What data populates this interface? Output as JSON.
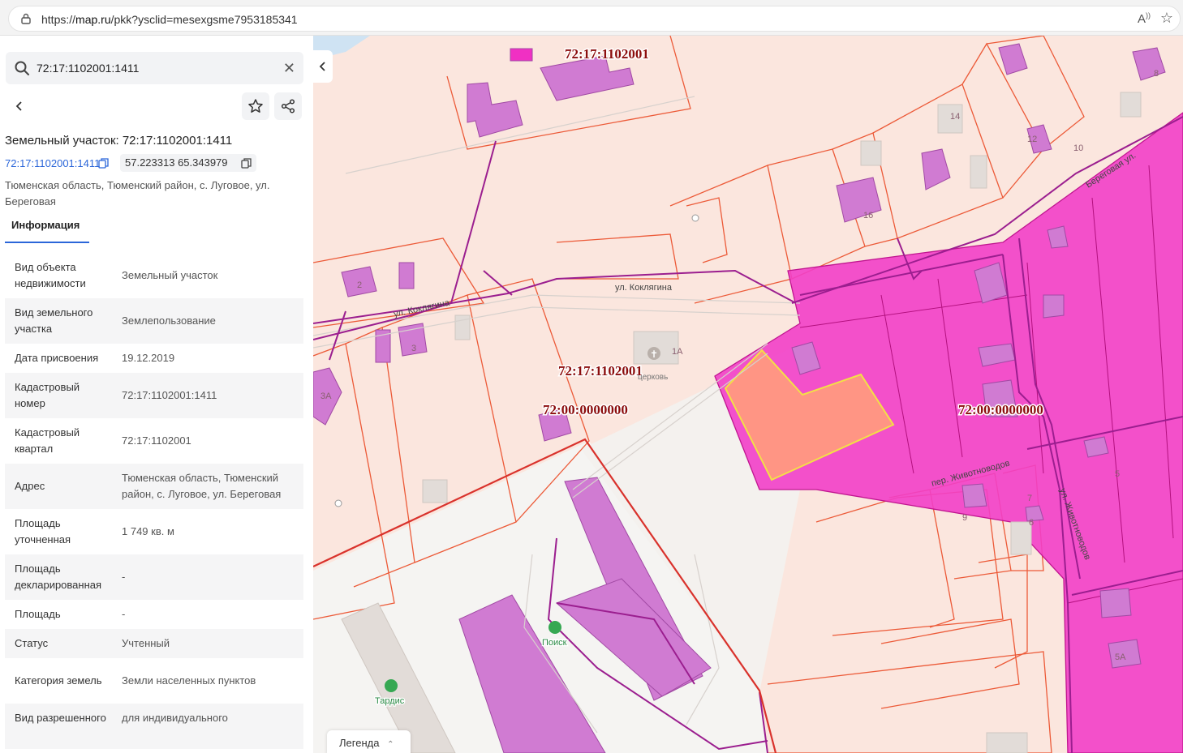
{
  "browser": {
    "url_prefix": "https://",
    "url_host": "map.ru",
    "url_path": "/pkk?ysclid=mesexgsme7953185341"
  },
  "search": {
    "value": "72:17:1102001:1411"
  },
  "parcel": {
    "title": "Земельный участок: 72:17:1102001:1411",
    "cad_number": "72:17:1102001:1411",
    "coordinates": "57.223313 65.343979",
    "address": "Тюменская область, Тюменский район, с. Луговое, ул. Береговая"
  },
  "tabs": {
    "info": "Информация"
  },
  "info_rows": [
    {
      "label": "Вид объекта недвижимости",
      "value": "Земельный участок"
    },
    {
      "label": "Вид земельного участка",
      "value": "Землепользование"
    },
    {
      "label": "Дата присвоения",
      "value": "19.12.2019"
    },
    {
      "label": "Кадастровый номер",
      "value": "72:17:1102001:1411"
    },
    {
      "label": "Кадастровый квартал",
      "value": "72:17:1102001"
    },
    {
      "label": "Адрес",
      "value": "Тюменская область, Тюменский район, с. Луговое, ул. Береговая"
    },
    {
      "label": "Площадь уточненная",
      "value": "1 749 кв. м"
    },
    {
      "label": "Площадь декларированная",
      "value": "-"
    },
    {
      "label": "Площадь",
      "value": "-"
    },
    {
      "label": "Статус",
      "value": "Учтенный"
    },
    {
      "label": "Категория земель",
      "value": "Земли населенных пунктов"
    },
    {
      "label": "Вид разрешенного",
      "value": "для индивидуального"
    }
  ],
  "map": {
    "quarter_labels": [
      "72:17:1102001",
      "72:17:1102001",
      "72:00:0000000",
      "72:00:0000000"
    ],
    "streets": [
      "ул. Коклягина",
      "ул. Коклягина",
      "пер. Животноводов",
      "ул. Животноводов",
      "Береговая ул."
    ],
    "house_numbers": [
      "2",
      "3",
      "3А",
      "1А",
      "14",
      "16",
      "12",
      "10",
      "8",
      "9",
      "7",
      "6",
      "5",
      "5А"
    ],
    "pois": [
      "Поиск",
      "Тардис"
    ],
    "church_label": "церковь",
    "legend": "Легенда"
  },
  "colors": {
    "parcel_fill": "#fbe4dc",
    "parcel_stroke": "#ec5a38",
    "quarter_fill": "#f23fc8",
    "building": "#d07bd2",
    "selected_fill": "#ff9584",
    "selected_stroke": "#f3e046",
    "network": "#9b1e8f",
    "quarter_text": "#8b0d0d",
    "link": "#2b66d9"
  }
}
